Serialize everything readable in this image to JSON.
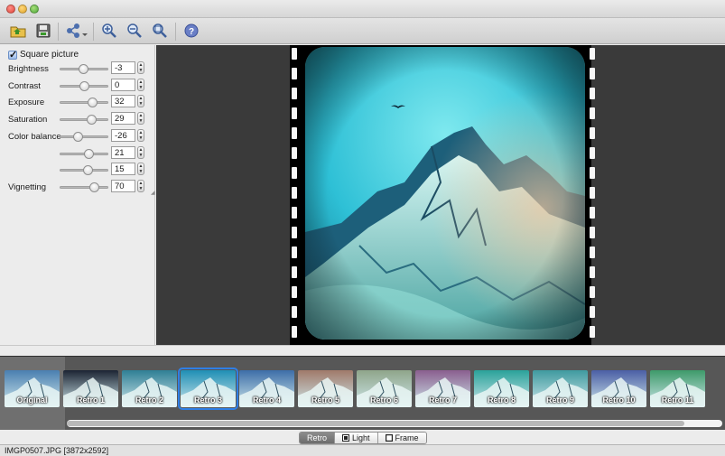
{
  "toolbar": {
    "buttons": [
      {
        "name": "open-folder-icon"
      },
      {
        "name": "save-icon"
      },
      {
        "name": "share-icon"
      },
      {
        "name": "zoom-in-icon"
      },
      {
        "name": "zoom-out-icon"
      },
      {
        "name": "zoom-fit-icon"
      },
      {
        "name": "help-icon"
      }
    ]
  },
  "panel": {
    "square_picture_label": "Square picture",
    "square_picture_checked": true,
    "rows": [
      {
        "label": "Brightness",
        "value": "-3",
        "level": 0.48
      },
      {
        "label": "Contrast",
        "value": "0",
        "level": 0.5
      },
      {
        "label": "Exposure",
        "value": "32",
        "level": 0.66
      },
      {
        "label": "Saturation",
        "value": "29",
        "level": 0.64
      },
      {
        "label": "Color balance",
        "value": "-26",
        "level": 0.37
      },
      {
        "label": "",
        "value": "21",
        "level": 0.6
      },
      {
        "label": "",
        "value": "15",
        "level": 0.57
      },
      {
        "label": "Vignetting",
        "value": "70",
        "level": 0.7
      }
    ]
  },
  "thumbnails": [
    {
      "label": "Original",
      "tint": "#4a7fb0"
    },
    {
      "label": "Retro 1",
      "tint": "#1c2433"
    },
    {
      "label": "Retro 2",
      "tint": "#2f7f95"
    },
    {
      "label": "Retro 3",
      "tint": "#1f8fb5"
    },
    {
      "label": "Retro 4",
      "tint": "#3d6ea8"
    },
    {
      "label": "Retro 5",
      "tint": "#a07a6a"
    },
    {
      "label": "Retro 6",
      "tint": "#8fa58a"
    },
    {
      "label": "Retro 7",
      "tint": "#8a5f8f"
    },
    {
      "label": "Retro 8",
      "tint": "#2aa29a"
    },
    {
      "label": "Retro 9",
      "tint": "#3f9a9f"
    },
    {
      "label": "Retro 10",
      "tint": "#4b5fa5"
    },
    {
      "label": "Retro 11",
      "tint": "#3e9a6a"
    }
  ],
  "selected_thumbnail": "Retro 3",
  "tabs": [
    {
      "label": "Retro",
      "active": true,
      "icon": "none"
    },
    {
      "label": "Light",
      "active": false,
      "icon": "light-icon"
    },
    {
      "label": "Frame",
      "active": false,
      "icon": "frame-icon"
    }
  ],
  "status": "IMGP0507.JPG [3872x2592]",
  "colors": {
    "accent": "#2f7fe6",
    "preview_bg": "#3a3a3a"
  }
}
